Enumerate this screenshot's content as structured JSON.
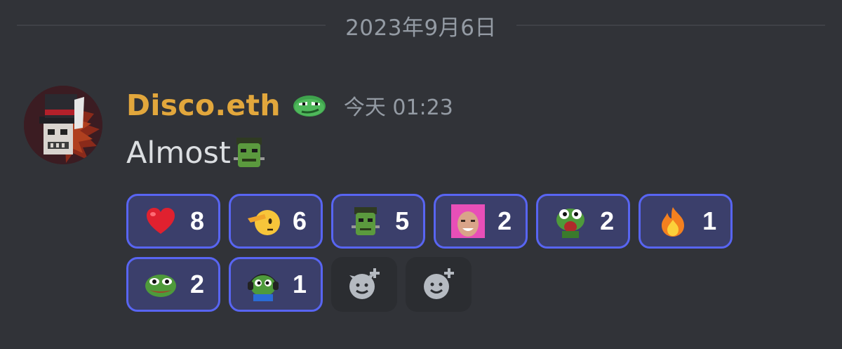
{
  "date_divider": {
    "label": "2023年9月6日"
  },
  "message": {
    "username": "Disco.eth",
    "timestamp": "今天 01:23",
    "text": "Almost",
    "colors": {
      "username": "#e2a73c",
      "timestamp": "#949ba4"
    },
    "role_icon": "pepe-smirk-icon",
    "inline_emoji": "frankenstein-emoji"
  },
  "reactions": [
    {
      "emoji": "red-heart-emoji",
      "count": "8"
    },
    {
      "emoji": "saluting-face-emoji",
      "count": "6"
    },
    {
      "emoji": "frankenstein-emoji",
      "count": "5"
    },
    {
      "emoji": "pink-guy-emoji",
      "count": "2"
    },
    {
      "emoji": "pepe-shouting-emoji",
      "count": "2"
    },
    {
      "emoji": "fire-emoji",
      "count": "1"
    },
    {
      "emoji": "pepe-emoji",
      "count": "2"
    },
    {
      "emoji": "pepe-headset-emoji",
      "count": "1"
    }
  ],
  "add_reaction_buttons": [
    {
      "icon": "add-super-reaction-icon"
    },
    {
      "icon": "add-reaction-icon"
    }
  ],
  "theme": {
    "background": "#313338",
    "reaction_border": "#5865f2",
    "reaction_bg": "#3b3f6b"
  }
}
